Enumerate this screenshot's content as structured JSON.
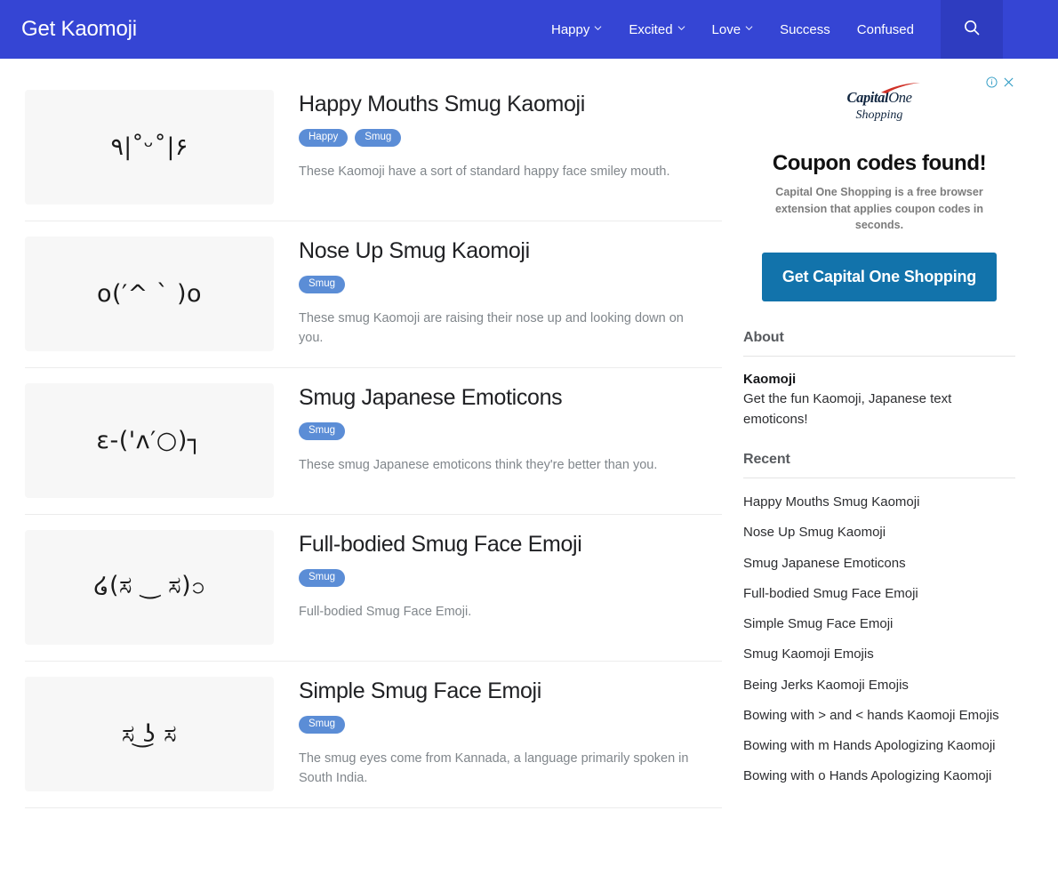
{
  "header": {
    "brand": "Get Kaomoji",
    "nav": [
      {
        "label": "Happy",
        "has_dropdown": true
      },
      {
        "label": "Excited",
        "has_dropdown": true
      },
      {
        "label": "Love",
        "has_dropdown": true
      },
      {
        "label": "Success",
        "has_dropdown": false
      },
      {
        "label": "Confused",
        "has_dropdown": false
      }
    ],
    "search_icon": "search-icon",
    "background_color": "#3545d4",
    "search_button_color": "#2e3cc0"
  },
  "cards": [
    {
      "kaomoji": "٩|˚ᵕ˚|۶",
      "title": "Happy Mouths Smug Kaomoji",
      "tags": [
        "Happy",
        "Smug"
      ],
      "description": "These Kaomoji have a sort of standard happy face smiley mouth."
    },
    {
      "kaomoji": "o(′^ ` )o",
      "title": "Nose Up Smug Kaomoji",
      "tags": [
        "Smug"
      ],
      "description": "These smug Kaomoji are raising their nose up and looking down on you."
    },
    {
      "kaomoji": "ε-('ʌ′○)┐",
      "title": "Smug Japanese Emoticons",
      "tags": [
        "Smug"
      ],
      "description": "These smug Japanese emoticons think they're better than you."
    },
    {
      "kaomoji": "໒(ಸ ‿ ಸ)၁",
      "title": "Full-bodied Smug Face Emoji",
      "tags": [
        "Smug"
      ],
      "description": "Full-bodied Smug Face Emoji."
    },
    {
      "kaomoji": "ಸ ͜ʖ ಸ",
      "title": "Simple Smug Face Emoji",
      "tags": [
        "Smug"
      ],
      "description": "The smug eyes come from Kannada, a language primarily spoken in South India."
    }
  ],
  "ad": {
    "info_icon": "info-icon",
    "close_icon": "close-icon",
    "brand_primary": "Capital",
    "brand_secondary": "One",
    "brand_tagline": "Shopping",
    "headline": "Coupon codes found!",
    "subtext": "Capital One Shopping is a free browser extension that applies coupon codes in seconds.",
    "cta_label": "Get Capital One Shopping",
    "cta_color": "#1273ab",
    "swoosh_color": "#d03027"
  },
  "sidebar": {
    "about": {
      "heading": "About",
      "name": "Kaomoji",
      "text": "Get the fun Kaomoji, Japanese text emoticons!"
    },
    "recent": {
      "heading": "Recent",
      "items": [
        "Happy Mouths Smug Kaomoji",
        "Nose Up Smug Kaomoji",
        "Smug Japanese Emoticons",
        "Full-bodied Smug Face Emoji",
        "Simple Smug Face Emoji",
        "Smug Kaomoji Emojis",
        "Being Jerks Kaomoji Emojis",
        "Bowing with > and < hands Kaomoji Emojis",
        "Bowing with m Hands Apologizing Kaomoji",
        "Bowing with o Hands Apologizing Kaomoji"
      ]
    }
  }
}
